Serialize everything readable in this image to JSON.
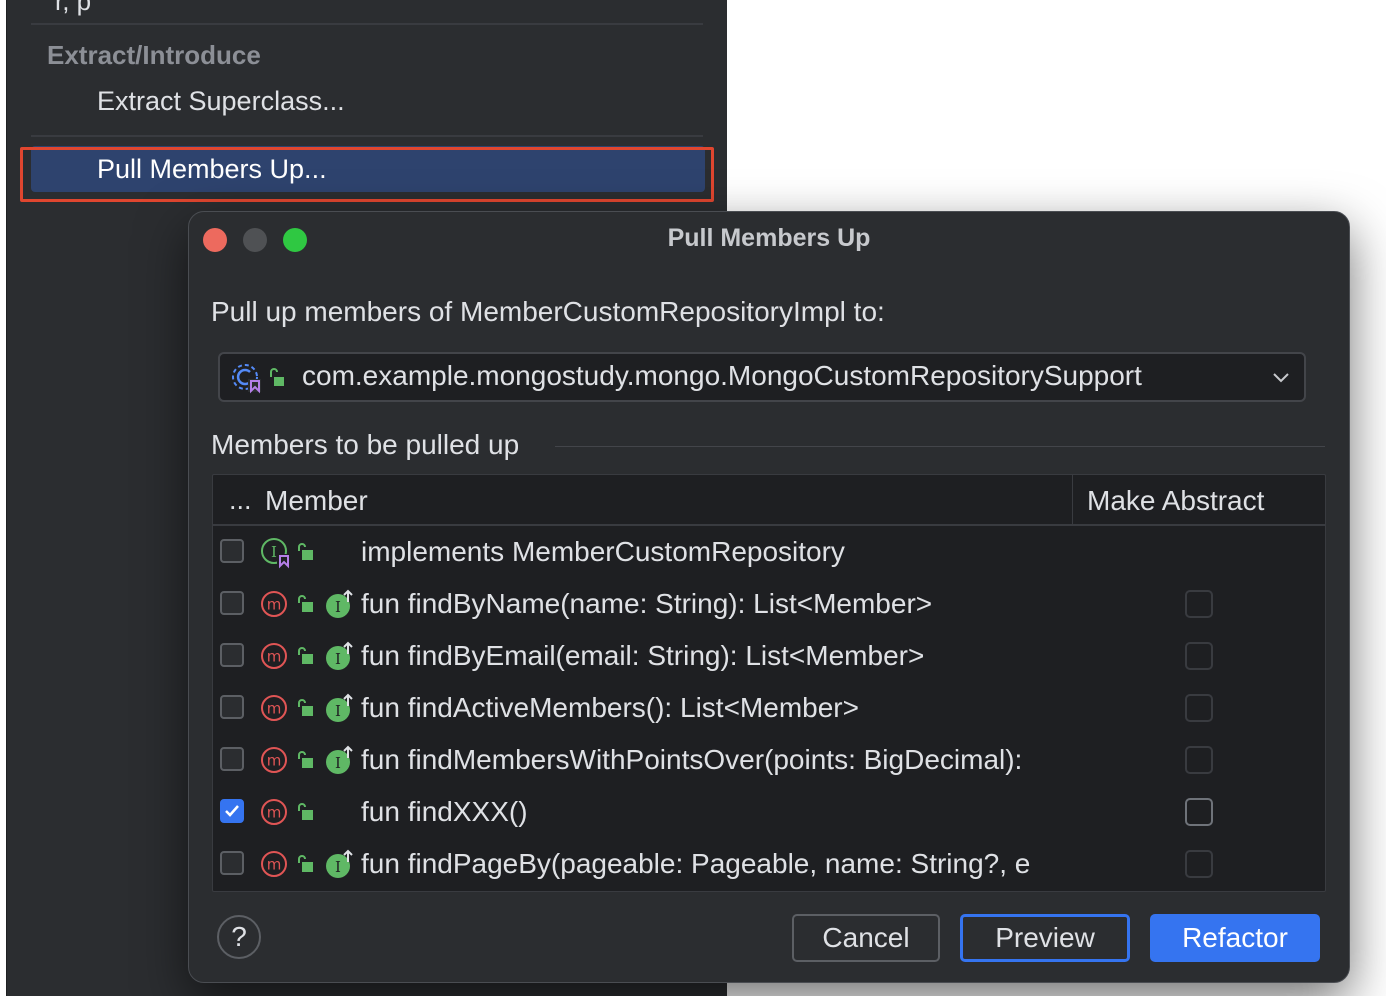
{
  "context_menu": {
    "partial_top_item": "r, p",
    "section_header": "Extract/Introduce",
    "items": [
      {
        "label": "Extract Superclass..."
      },
      {
        "label": "Pull Members Up..."
      }
    ],
    "highlight_color": "#e0462f",
    "selected_color": "#2e436e"
  },
  "dialog": {
    "title": "Pull Members Up",
    "pull_up_label": "Pull up members of MemberCustomRepositoryImpl to:",
    "target": {
      "value": "com.example.mongostudy.mongo.MongoCustomRepositorySupport",
      "icon": "abstract-class-icon"
    },
    "members_section_label": "Members to be pulled up",
    "table": {
      "col_check": "...",
      "col_member": "Member",
      "col_abstract": "Make Abstract",
      "rows": [
        {
          "text": "implements MemberCustomRepository",
          "checked": false,
          "kind": "interface",
          "abstract_enabled": false
        },
        {
          "text": "fun findByName(name: String): List<Member>",
          "checked": false,
          "kind": "method-implementing",
          "abstract_enabled": false
        },
        {
          "text": "fun findByEmail(email: String): List<Member>",
          "checked": false,
          "kind": "method-implementing",
          "abstract_enabled": false
        },
        {
          "text": "fun findActiveMembers(): List<Member>",
          "checked": false,
          "kind": "method-implementing",
          "abstract_enabled": false
        },
        {
          "text": "fun findMembersWithPointsOver(points: BigDecimal):",
          "checked": false,
          "kind": "method-implementing",
          "abstract_enabled": false
        },
        {
          "text": "fun findXXX()",
          "checked": true,
          "kind": "method",
          "abstract_enabled": true
        },
        {
          "text": "fun findPageBy(pageable: Pageable, name: String?, e",
          "checked": false,
          "kind": "method-implementing",
          "abstract_enabled": false
        }
      ]
    },
    "help_label": "?",
    "buttons": {
      "cancel": "Cancel",
      "preview": "Preview",
      "refactor": "Refactor"
    },
    "accent_color": "#3574f0"
  }
}
